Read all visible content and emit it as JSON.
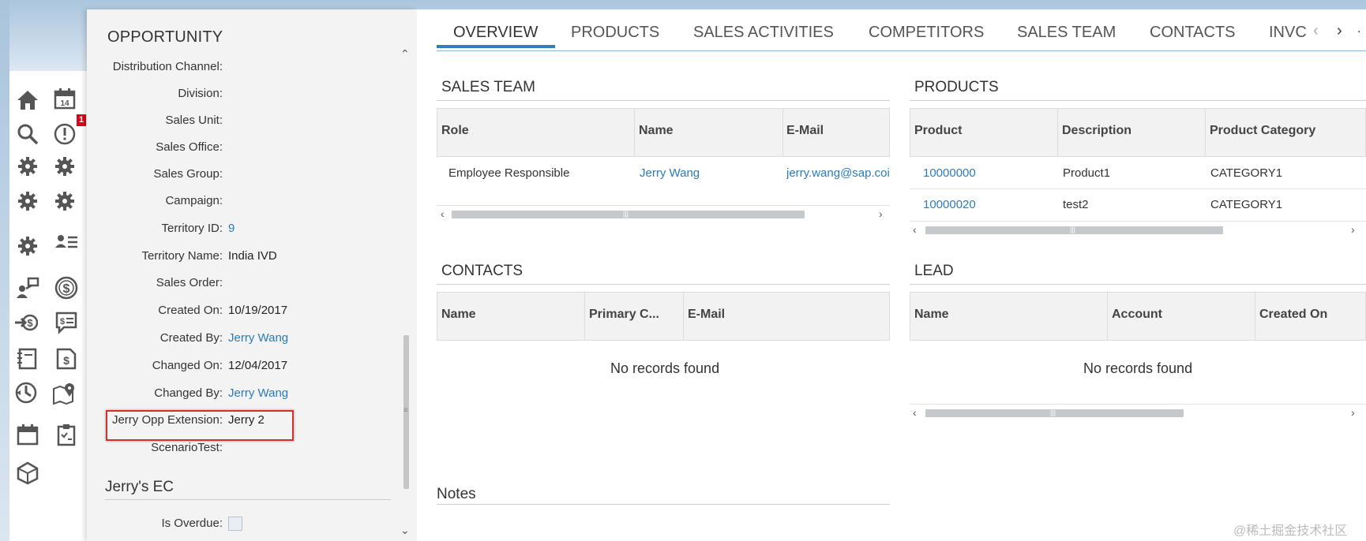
{
  "rail": {
    "badge_count": "1",
    "icons": [
      "home-icon",
      "calendar-icon",
      "search-icon",
      "alert-icon",
      "gear-icon",
      "gear-icon",
      "gear-icon",
      "gear-icon",
      "gear-icon",
      "people-list-icon",
      "org-chart-icon",
      "dollar-icon",
      "transfer-dollar-icon",
      "quote-icon",
      "document-icon",
      "invoice-icon",
      "renew-icon",
      "map-pin-icon",
      "calendar-icon",
      "clipboard-icon",
      "cube-icon"
    ]
  },
  "opportunity": {
    "title": "OPPORTUNITY",
    "fields": [
      {
        "label": "Distribution Channel:",
        "value": ""
      },
      {
        "label": "Division:",
        "value": ""
      },
      {
        "label": "Sales Unit:",
        "value": ""
      },
      {
        "label": "Sales Office:",
        "value": ""
      },
      {
        "label": "Sales Group:",
        "value": ""
      },
      {
        "label": "Campaign:",
        "value": ""
      },
      {
        "label": "Territory ID:",
        "value": "9"
      },
      {
        "label": "Territory Name:",
        "value": "India IVD"
      },
      {
        "label": "Sales Order:",
        "value": ""
      },
      {
        "label": "Created On:",
        "value": "10/19/2017"
      },
      {
        "label": "Created By:",
        "value": "Jerry Wang"
      },
      {
        "label": "Changed On:",
        "value": "12/04/2017"
      },
      {
        "label": "Changed By:",
        "value": "Jerry Wang"
      },
      {
        "label": "Jerry Opp Extension:",
        "value": "Jerry 2"
      },
      {
        "label": "ScenarioTest:",
        "value": ""
      }
    ],
    "section2_title": "Jerry's EC",
    "overdue_label": "Is Overdue:",
    "overdue_checked": false
  },
  "tabs": [
    "OVERVIEW",
    "PRODUCTS",
    "SALES ACTIVITIES",
    "COMPETITORS",
    "SALES TEAM",
    "CONTACTS",
    "INVC"
  ],
  "active_tab": "OVERVIEW",
  "sales_team": {
    "title": "SALES TEAM",
    "columns": [
      "Role",
      "Name",
      "E-Mail"
    ],
    "rows": [
      {
        "role": "Employee Responsible",
        "name": "Jerry Wang",
        "email": "jerry.wang@sap.coi"
      }
    ]
  },
  "products": {
    "title": "PRODUCTS",
    "columns": [
      "Product",
      "Description",
      "Product Category"
    ],
    "rows": [
      {
        "product": "10000000",
        "description": "Product1",
        "category": "CATEGORY1"
      },
      {
        "product": "10000020",
        "description": "test2",
        "category": "CATEGORY1"
      }
    ]
  },
  "contacts": {
    "title": "CONTACTS",
    "columns": [
      "Name",
      "Primary C...",
      "E-Mail"
    ],
    "empty": "No records found"
  },
  "lead": {
    "title": "LEAD",
    "columns": [
      "Name",
      "Account",
      "Created On"
    ],
    "empty": "No records found"
  },
  "notes": {
    "title": "Notes"
  },
  "watermark": "@稀土掘金技术社区",
  "colors": {
    "accent": "#2f7fc7",
    "link": "#2b7bb9",
    "highlight": "#d32f2f",
    "badge": "#e0001a"
  }
}
